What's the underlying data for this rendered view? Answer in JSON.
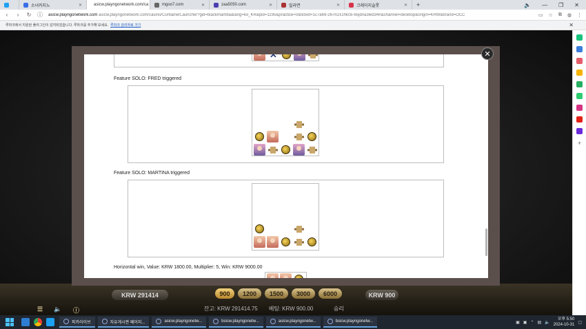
{
  "browser": {
    "tabs": [
      {
        "label": "소녀커지노"
      },
      {
        "label": "asicw.playngonetwork.com/ca"
      },
      {
        "label": "mgoo7.com"
      },
      {
        "label": "zaa5050.com"
      },
      {
        "label": "밀라면"
      },
      {
        "label": "크레이지슬롯"
      }
    ],
    "new_tab": "+",
    "window_controls": {
      "minimize": "—",
      "restore": "❐",
      "close": "✕"
    },
    "url_host": "asicw.playngonetwork.com",
    "url_path": "asicw.playngonetwork.com/casino/ContainerLauncher?gid=blackmamba&lang=ko_KR&pid=1195&practice=0&ticket=1c7a69-26-m2x1hkc6-65jdna3led34n&channel=desktop&origin=KRW&brand=OCC",
    "infobar_text": "루마크에서 지원된 플러그인이 감지되었습니다. 루마크를 추가해 보세요.",
    "infobar_link": "루마크 관리자로 가기",
    "infobar_close": "✕"
  },
  "modal": {
    "close": "✕",
    "sections": [
      {
        "label": "Feature SOLO: FRED triggered"
      },
      {
        "label": "Feature SOLO: MARTINA triggered"
      },
      {
        "label": "Horizontal win, Value: KRW 1800.00, Multiplier: 5, Win: KRW 9000.00"
      }
    ]
  },
  "game_bar": {
    "balance": "KRW 291414",
    "bet_options": [
      "900",
      "1200",
      "1500",
      "3000",
      "6000"
    ],
    "selected_bet": "900",
    "bet_total": "KRW 900",
    "bottom_balance": "잔고: KRW 291414.75",
    "bottom_bet": "베팅: KRW 900.00",
    "bottom_win": "승리"
  },
  "taskbar": {
    "apps": [
      {
        "label": "피카라이브"
      },
      {
        "label": "자유게시판 페이지..."
      },
      {
        "label": "asicw.playngonetw..."
      },
      {
        "label": "bsicw.playngonetw..."
      },
      {
        "label": "asicw.playngonetw..."
      },
      {
        "label": "bsicw.playngonetw..."
      }
    ],
    "clock_time": "오후 5:50",
    "clock_date": "2024-10-31"
  },
  "colors": {
    "accent_gold": "#d9c28a",
    "modal_frame": "#5b4f4c",
    "taskbar": "#1f2630"
  }
}
